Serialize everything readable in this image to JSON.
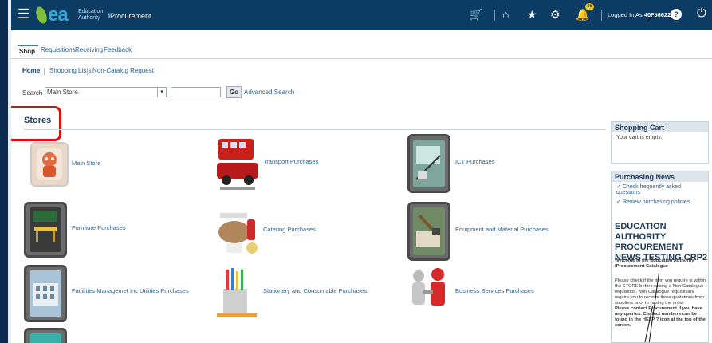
{
  "header": {
    "logo_text": "ea",
    "logo_sub_1": "Education",
    "logo_sub_2": "Authority",
    "app_name": "iProcurement",
    "notification_count": "46",
    "logged_in_prefix": "Logged In As",
    "username": "40656622"
  },
  "tabs": [
    {
      "label": "Shop",
      "active": true
    },
    {
      "label": "Requisitions"
    },
    {
      "label": "Receiving"
    },
    {
      "label": "Feedback"
    }
  ],
  "subtabs": [
    {
      "label": "Home",
      "active": true
    },
    {
      "label": "Shopping Lists"
    },
    {
      "label": "Non-Catalog Request"
    }
  ],
  "search": {
    "label": "Search",
    "selected": "Main Store",
    "go_label": "Go",
    "advanced_label": "Advanced Search"
  },
  "stores": {
    "title": "Stores",
    "items": [
      {
        "label": "Main Store"
      },
      {
        "label": "Transport Purchases"
      },
      {
        "label": "ICT Purchases"
      },
      {
        "label": "Furniture Purchases"
      },
      {
        "label": "Catering Purchases"
      },
      {
        "label": "Equipment and Material Purchases"
      },
      {
        "label": "Facilities Managemet Inc Utilities Purchases"
      },
      {
        "label": "Stationery and Consumable Purchases"
      },
      {
        "label": "Business Services Purchases"
      }
    ]
  },
  "cart": {
    "title": "Shopping Cart",
    "empty_text": "Your cart is empty."
  },
  "news": {
    "title": "Purchasing News",
    "links": [
      "Check frequently asked questions",
      "Review purchasing policies"
    ],
    "headline": "EDUCATION AUTHORITY PROCUREMENT NEWS TESTING CRP2",
    "welcome": "Welcome to the Education Authority iProcurement Catalogue",
    "para1": "Please check if the item you require is within the STORE before raising a Non Catalogue requisition. Non Catalogue requisitions require you to receive three quotations from suppliers prior to raising the order.",
    "para2": "Please contact Procurement if you have any queries. Contact numbers can be found in the HELP ? icon at the top of the screen."
  },
  "colors": {
    "header_bg": "#0c3b63",
    "link": "#2b5f8f",
    "highlight": "#e30b0b"
  }
}
